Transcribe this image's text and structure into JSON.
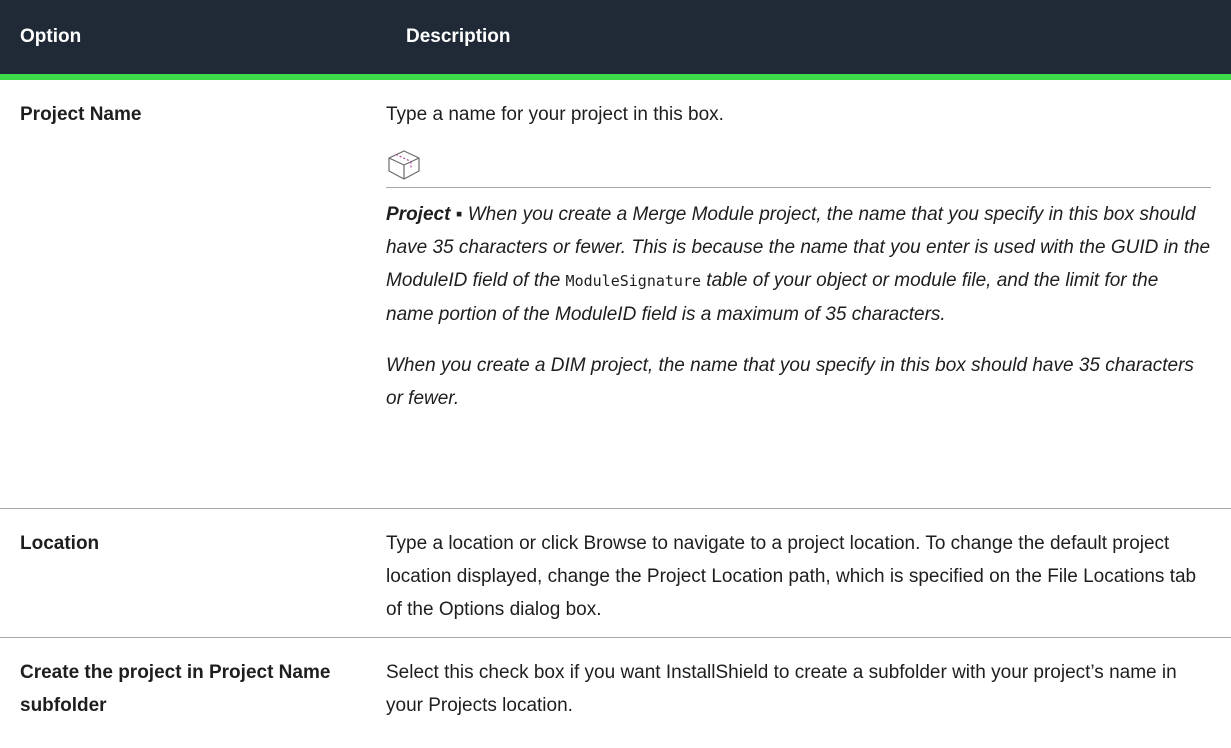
{
  "table": {
    "headers": {
      "option": "Option",
      "description": "Description"
    },
    "rows": {
      "project_name": {
        "option": "Project Name",
        "description": "Type a name for your project in this box.",
        "note": {
          "icon": "project-box-icon",
          "lead": "Project",
          "separator": " ▪ ",
          "text_before_code": "When you create a Merge Module project, the name that you specify in this box should have 35 characters or fewer. This is because the name that you enter is used with the GUID in the ModuleID field of the ",
          "code": "ModuleSignature",
          "text_after_code": " table of your object or module file, and the limit for the name portion of the ModuleID field is a maximum of 35 characters.",
          "paragraph2": "When you create a DIM project, the name that you specify in this box should have 35 characters or fewer."
        }
      },
      "location": {
        "option": "Location",
        "description": "Type a location or click Browse to navigate to a project location. To change the default project location displayed, change the Project Location path, which is specified on the File Locations tab of the Options dialog box."
      },
      "create_subfolder": {
        "option": "Create the project in Project Name subfolder",
        "description": "Select this check box if you want InstallShield to create a subfolder with your project’s name in your Projects location."
      }
    }
  },
  "colors": {
    "header_bg": "#202a36",
    "header_text": "#ffffff",
    "accent_line": "#3ddc4a",
    "divider": "#a8a8a8"
  }
}
